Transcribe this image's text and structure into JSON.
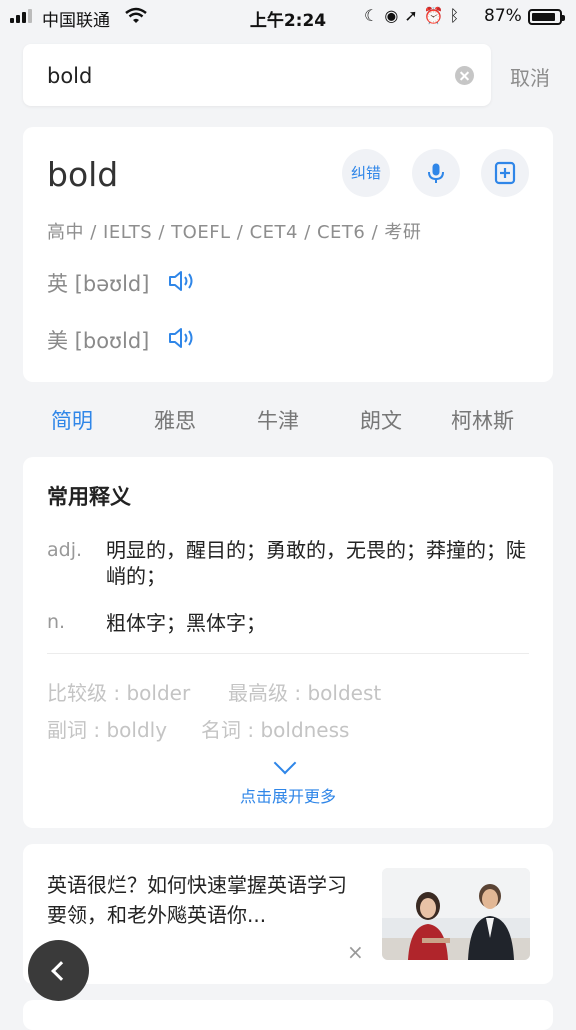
{
  "status_bar": {
    "carrier": "中国联通",
    "time": "上午2:24",
    "battery": "87%",
    "battery_level": 0.87
  },
  "search": {
    "value": "bold",
    "cancel_label": "取消"
  },
  "word_card": {
    "word": "bold",
    "correct_label": "纠错",
    "levels": "高中 / IELTS / TOEFL / CET4 / CET6 / 考研",
    "pron_uk": "英 [bəʊld]",
    "pron_us": "美 [boʊld]"
  },
  "dict_tabs": [
    "简明",
    "雅思",
    "牛津",
    "朗文",
    "柯林斯"
  ],
  "definitions": {
    "title": "常用释义",
    "items": [
      {
        "pos": "adj.",
        "meaning": "明显的，醒目的；勇敢的，无畏的；莽撞的；陡峭的；"
      },
      {
        "pos": "n.",
        "meaning": "粗体字；黑体字；"
      }
    ],
    "comparative": "比较级 : bolder",
    "superlative": "最高级 : boldest",
    "adverb": "副词 : boldly",
    "noun": "名词 : boldness",
    "expand_label": "点击展开更多"
  },
  "ad": {
    "text": "英语很烂？如何快速掌握英语学习要领，和老外飚英语你...",
    "close": "×"
  },
  "colors": {
    "accent": "#2f86e8",
    "background": "#f3f4f6"
  }
}
